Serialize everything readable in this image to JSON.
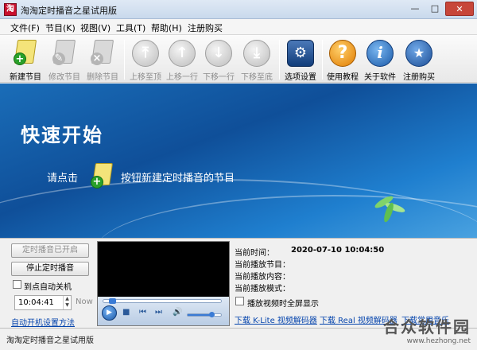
{
  "window": {
    "title": "淘淘定时播音之星试用版",
    "app_icon_text": "淘"
  },
  "menu": [
    "文件(F)",
    "节目(K)",
    "视图(V)",
    "工具(T)",
    "帮助(H)",
    "注册购买"
  ],
  "toolbar": {
    "new_program": "新建节目",
    "edit_program": "修改节目",
    "delete_program": "删除节目",
    "move_top": "上移至顶",
    "move_up": "上移一行",
    "move_down": "下移一行",
    "move_bottom": "下移至底",
    "settings": "选项设置",
    "tutorial": "使用教程",
    "about": "关于软件",
    "register": "注册购买"
  },
  "banner": {
    "title": "快速开始",
    "instruction_prefix": "请点击",
    "instruction_suffix": "按钮新建定时播音的节目"
  },
  "controls": {
    "timer_started": "定时播音已开启",
    "stop_timer": "停止定时播音",
    "auto_shutdown": "到点自动关机",
    "shutdown_time": "10:04:41",
    "now_label": "Now",
    "auto_start_link": "自动开机设置方法"
  },
  "player": {
    "seek_position": 0.05,
    "volume": 0.72
  },
  "info": {
    "current_time_label": "当前时间：",
    "current_time_value": "2020-07-10 10:04:50",
    "current_program_label": "当前播放节目：",
    "current_content_label": "当前播放内容：",
    "current_mode_label": "当前播放模式：",
    "fullscreen_label": "播放视频时全屏显示"
  },
  "downloads": {
    "klite": "下载 K-Lite 视频解码器",
    "real": "下载 Real 视频解码器",
    "common": "下载常用音乐"
  },
  "status": {
    "text": "淘淘定时播音之星试用版"
  },
  "watermark": {
    "name": "合众软件园",
    "url": "www.hezhong.net"
  }
}
